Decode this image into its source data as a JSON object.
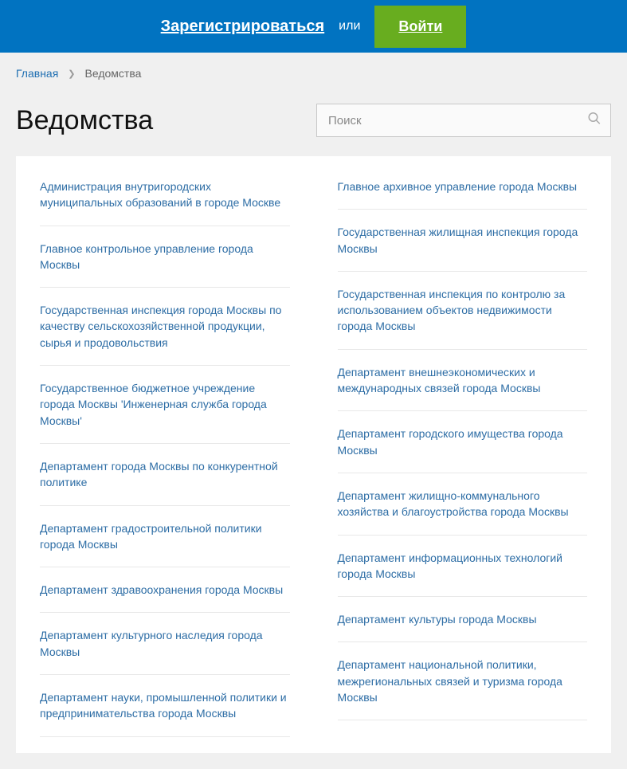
{
  "topbar": {
    "register": "Зарегистрироваться",
    "or": "или",
    "login": "Войти"
  },
  "breadcrumb": {
    "home": "Главная",
    "current": "Ведомства"
  },
  "page": {
    "title": "Ведомства"
  },
  "search": {
    "placeholder": "Поиск"
  },
  "departments": {
    "left": [
      "Администрация внутригородских муниципальных образований в городе Москве",
      "Главное контрольное управление города Москвы",
      "Государственная инспекция города Москвы по качеству сельскохозяйственной продукции, сырья и продовольствия",
      "Государственное бюджетное учреждение города Москвы 'Инженерная служба города Москвы'",
      "Департамент города Москвы по конкурентной политике",
      "Департамент градостроительной политики города Москвы",
      "Департамент здравоохранения города Москвы",
      "Департамент культурного наследия города Москвы",
      "Департамент науки, промышленной политики и предпринимательства города Москвы"
    ],
    "right": [
      "Главное архивное управление города Москвы",
      "Государственная жилищная инспекция города Москвы",
      "Государственная инспекция по контролю за использованием объектов недвижимости города Москвы",
      "Департамент внешнеэкономических и международных связей города Москвы",
      "Департамент городского имущества города Москвы",
      "Департамент жилищно-коммунального хозяйства и благоустройства города Москвы",
      "Департамент информационных технологий города Москвы",
      "Департамент культуры города Москвы",
      "Департамент национальной политики, межрегиональных связей и туризма города Москвы"
    ]
  }
}
